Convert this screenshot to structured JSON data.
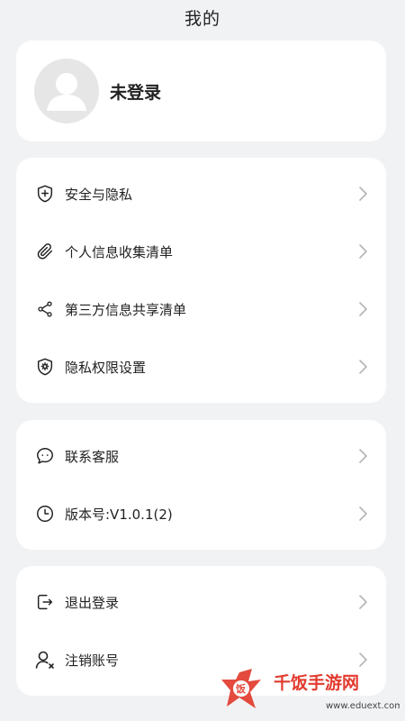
{
  "header": {
    "title": "我的"
  },
  "profile": {
    "status": "未登录"
  },
  "groups": [
    [
      {
        "label": "安全与隐私",
        "icon": "shield-plus-icon"
      },
      {
        "label": "个人信息收集清单",
        "icon": "paperclip-icon"
      },
      {
        "label": "第三方信息共享清单",
        "icon": "share-icon"
      },
      {
        "label": "隐私权限设置",
        "icon": "privacy-settings-icon"
      }
    ],
    [
      {
        "label": "联系客服",
        "icon": "chat-bubble-icon"
      },
      {
        "label": "版本号:V1.0.1(2)",
        "icon": "clock-icon"
      }
    ],
    [
      {
        "label": "退出登录",
        "icon": "logout-icon"
      },
      {
        "label": "注销账号",
        "icon": "user-remove-icon"
      }
    ]
  ],
  "watermark": {
    "text": "千饭手游网",
    "url": "www.eduext.com"
  }
}
